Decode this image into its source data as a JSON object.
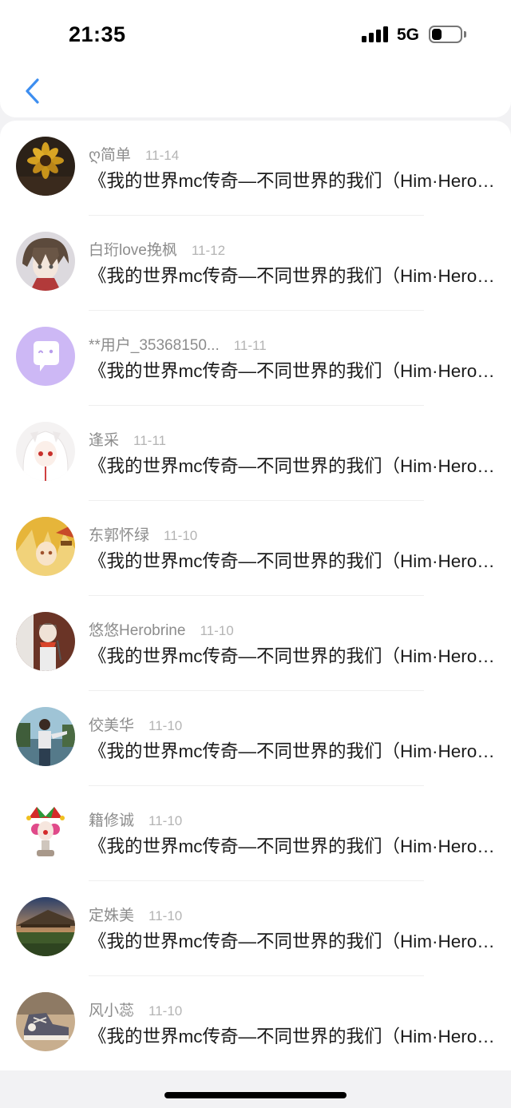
{
  "status_bar": {
    "time": "21:35",
    "network": "5G",
    "battery_level": 0.35
  },
  "nav": {
    "back_icon": "chevron-left-icon",
    "accent_color": "#3d8ef0"
  },
  "comments": [
    {
      "name": "ღ简单",
      "date": "11-14",
      "text": "《我的世界mc传奇—不同世界的我们（Him·Herobrine）》",
      "avatar": "sunflower-avatar"
    },
    {
      "name": "白珩love挽枫",
      "date": "11-12",
      "text": "《我的世界mc传奇—不同世界的我们（Him·Herobrine）》",
      "avatar": "anime-boy-avatar"
    },
    {
      "name": "**用户_35368150...",
      "date": "11-11",
      "text": "《我的世界mc传奇—不同世界的我们（Him·Herobrine）》",
      "avatar": "default-chat-avatar"
    },
    {
      "name": "逢采",
      "date": "11-11",
      "text": "《我的世界mc传奇—不同世界的我们（Him·Herobrine）》",
      "avatar": "white-hair-girl-avatar"
    },
    {
      "name": "东郭怀绿",
      "date": "11-10",
      "text": "《我的世界mc传奇—不同世界的我们（Him·Herobrine）》",
      "avatar": "blonde-anime-avatar"
    },
    {
      "name": "悠悠Herobrine",
      "date": "11-10",
      "text": "《我的世界mc传奇—不同世界的我们（Him·Herobrine）》",
      "avatar": "scarf-boy-avatar"
    },
    {
      "name": "佼美华",
      "date": "11-10",
      "text": "《我的世界mc传奇—不同世界的我们（Him·Herobrine）》",
      "avatar": "photo-man-avatar"
    },
    {
      "name": "籍修诚",
      "date": "11-10",
      "text": "《我的世界mc传奇—不同世界的我们（Him·Herobrine）》",
      "avatar": "clown-avatar"
    },
    {
      "name": "定姝美",
      "date": "11-10",
      "text": "《我的世界mc传奇—不同世界的我们（Him·Herobrine）》",
      "avatar": "landscape-avatar"
    },
    {
      "name": "风小蕊",
      "date": "11-10",
      "text": "《我的世界mc传奇—不同世界的我们（Him·Herobrine）》",
      "avatar": "sneaker-avatar"
    }
  ]
}
